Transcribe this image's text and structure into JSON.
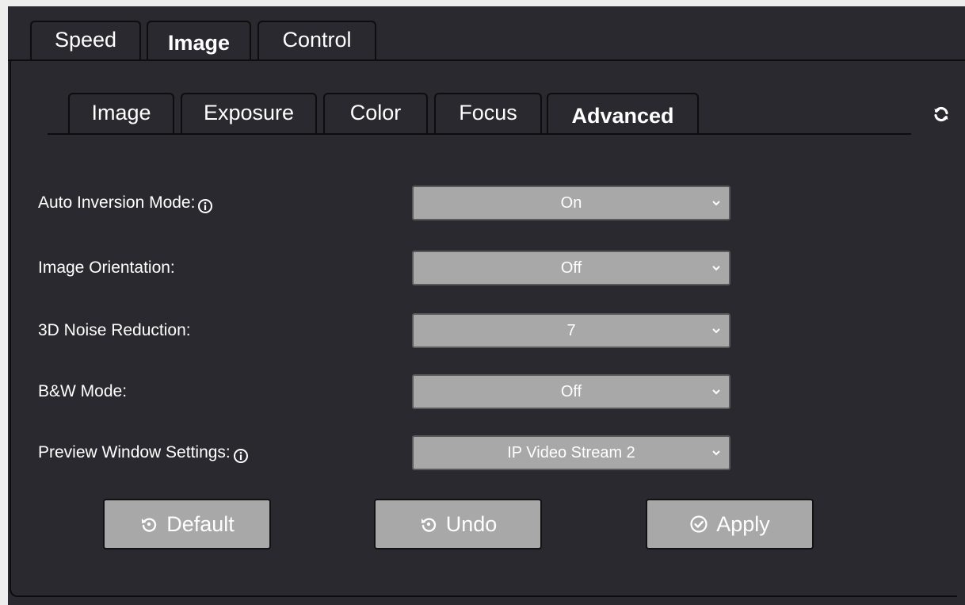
{
  "top_tabs": [
    {
      "label": "Speed",
      "active": false
    },
    {
      "label": "Image",
      "active": true
    },
    {
      "label": "Control",
      "active": false
    }
  ],
  "sub_tabs": [
    {
      "label": "Image",
      "active": false
    },
    {
      "label": "Exposure",
      "active": false
    },
    {
      "label": "Color",
      "active": false
    },
    {
      "label": "Focus",
      "active": false
    },
    {
      "label": "Advanced",
      "active": true
    }
  ],
  "settings": [
    {
      "label": "Auto Inversion Mode:",
      "value": "On",
      "info": true
    },
    {
      "label": "Image Orientation:",
      "value": "Off",
      "info": false
    },
    {
      "label": "3D Noise Reduction:",
      "value": "7",
      "info": false
    },
    {
      "label": "B&W Mode:",
      "value": "Off",
      "info": false
    },
    {
      "label": "Preview Window Settings:",
      "value": "IP Video Stream 2",
      "info": true
    }
  ],
  "buttons": {
    "default_label": "Default",
    "undo_label": "Undo",
    "apply_label": "Apply"
  },
  "icons": {
    "refresh": "refresh-icon",
    "info": "info-icon",
    "dropdown": "chevron-down-icon",
    "default": "reset-icon",
    "undo": "undo-icon",
    "apply": "check-circle-icon"
  },
  "colors": {
    "background": "#2a292f",
    "control": "#a8a8a8",
    "text": "#ffffff",
    "border": "#0d0d0d"
  }
}
